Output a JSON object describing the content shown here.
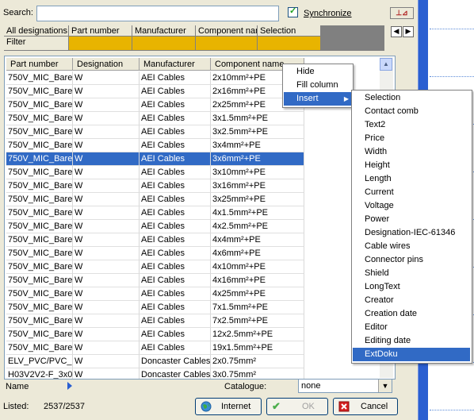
{
  "search": {
    "label": "Search:",
    "value": ""
  },
  "synchronize": {
    "label": "Synchronize",
    "checked": true
  },
  "filter_grid": {
    "headers": [
      "All designations",
      "Part number",
      "Manufacturer",
      "Component nan",
      "Selection"
    ],
    "filter_label": "Filter"
  },
  "grid": {
    "headers": [
      "Part number",
      "Designation",
      "Manufacturer",
      "Component name"
    ],
    "rows": [
      [
        "750V_MIC_Bare",
        "W",
        "AEI Cables",
        "2x10mm²+PE"
      ],
      [
        "750V_MIC_Bare",
        "W",
        "AEI Cables",
        "2x16mm²+PE"
      ],
      [
        "750V_MIC_Bare",
        "W",
        "AEI Cables",
        "2x25mm²+PE"
      ],
      [
        "750V_MIC_Bare",
        "W",
        "AEI Cables",
        "3x1.5mm²+PE"
      ],
      [
        "750V_MIC_Bare",
        "W",
        "AEI Cables",
        "3x2.5mm²+PE"
      ],
      [
        "750V_MIC_Bare",
        "W",
        "AEI Cables",
        "3x4mm²+PE"
      ],
      [
        "750V_MIC_Bare",
        "W",
        "AEI Cables",
        "3x6mm²+PE"
      ],
      [
        "750V_MIC_Bare",
        "W",
        "AEI Cables",
        "3x10mm²+PE"
      ],
      [
        "750V_MIC_Bare",
        "W",
        "AEI Cables",
        "3x16mm²+PE"
      ],
      [
        "750V_MIC_Bare",
        "W",
        "AEI Cables",
        "3x25mm²+PE"
      ],
      [
        "750V_MIC_Bare",
        "W",
        "AEI Cables",
        "4x1.5mm²+PE"
      ],
      [
        "750V_MIC_Bare",
        "W",
        "AEI Cables",
        "4x2.5mm²+PE"
      ],
      [
        "750V_MIC_Bare",
        "W",
        "AEI Cables",
        "4x4mm²+PE"
      ],
      [
        "750V_MIC_Bare",
        "W",
        "AEI Cables",
        "4x6mm²+PE"
      ],
      [
        "750V_MIC_Bare",
        "W",
        "AEI Cables",
        "4x10mm²+PE"
      ],
      [
        "750V_MIC_Bare",
        "W",
        "AEI Cables",
        "4x16mm²+PE"
      ],
      [
        "750V_MIC_Bare",
        "W",
        "AEI Cables",
        "4x25mm²+PE"
      ],
      [
        "750V_MIC_Bare",
        "W",
        "AEI Cables",
        "7x1.5mm²+PE"
      ],
      [
        "750V_MIC_Bare",
        "W",
        "AEI Cables",
        "7x2.5mm²+PE"
      ],
      [
        "750V_MIC_Bare",
        "W",
        "AEI Cables",
        "12x2.5mm²+PE"
      ],
      [
        "750V_MIC_Bare",
        "W",
        "AEI Cables",
        "19x1.5mm²+PE"
      ],
      [
        "ELV_PVC/PVC_:",
        "W",
        "Doncaster Cables",
        "2x0.75mm²"
      ],
      [
        "H03V2V2-F_3x0",
        "W",
        "Doncaster Cables",
        "3x0.75mm²"
      ]
    ],
    "selected_row": 6
  },
  "context_menu": {
    "items": [
      "Hide",
      "Fill column",
      "Insert"
    ],
    "highlighted": 2,
    "submenu_arrow": "▶"
  },
  "submenu": {
    "items": [
      "Selection",
      "Contact comb",
      "Text2",
      "Price",
      "Width",
      "Height",
      "Length",
      "Current",
      "Voltage",
      "Power",
      "Designation-IEC-61346",
      "Cable wires",
      "Connector pins",
      "Shield",
      "LongText",
      "Creator",
      "Creation date",
      "Editor",
      "Editing date",
      "ExtDoku"
    ],
    "highlighted": 19
  },
  "footer": {
    "name_label": "Name",
    "catalogue_label": "Catalogue:",
    "catalogue_value": "none",
    "listed_label": "Listed:",
    "listed_value": "2537/2537",
    "internet_label": "Internet",
    "ok_label": "OK",
    "cancel_label": "Cancel"
  },
  "colors": {
    "selection": "#316ac5",
    "filter_row": "#e8b400",
    "dialog_bg": "#ece9d8"
  }
}
